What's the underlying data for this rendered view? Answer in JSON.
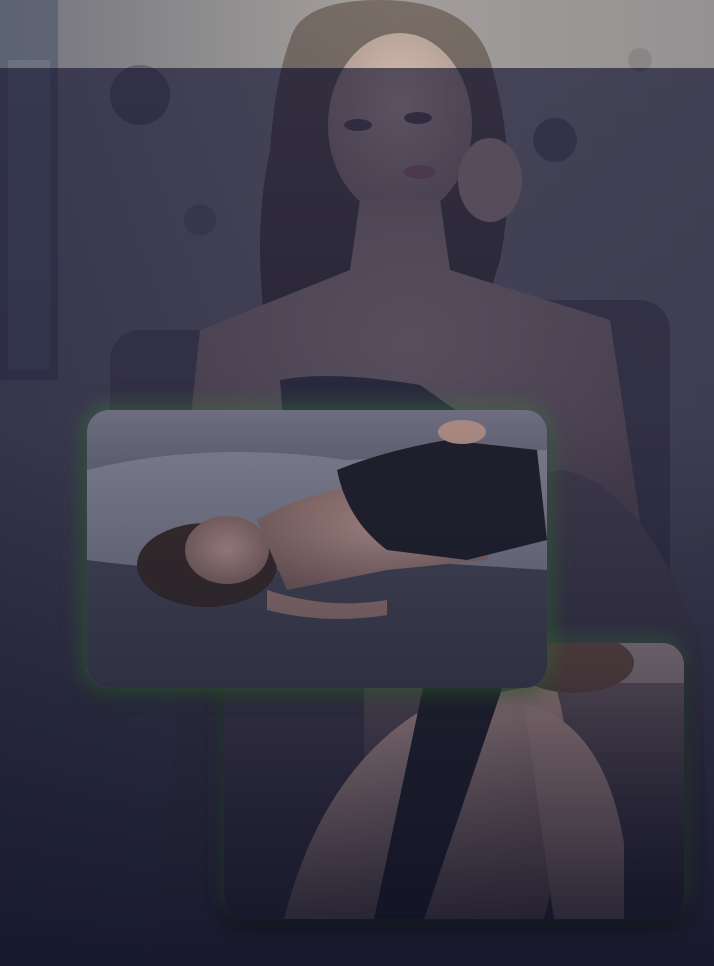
{
  "page": {
    "theme": {
      "background": "#16182c",
      "overlay": "#2c2c46",
      "glow": "#468c46"
    }
  },
  "hero": {
    "image": "portrait-photo",
    "alt": ""
  },
  "gallery": {
    "cards": [
      {
        "name": "reclining-portrait-photo",
        "alt": ""
      },
      {
        "name": "seated-portrait-photo",
        "alt": ""
      }
    ]
  }
}
